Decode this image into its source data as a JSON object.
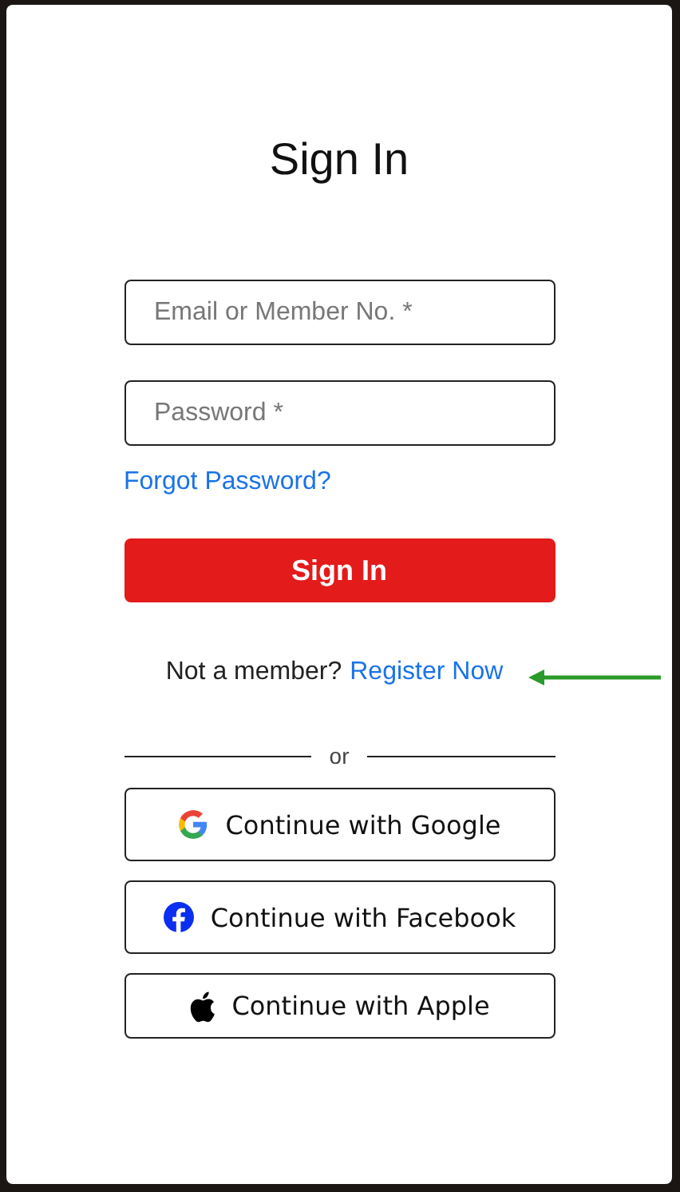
{
  "title": "Sign In",
  "fields": [
    {
      "placeholder": "Email or Member No. *"
    },
    {
      "placeholder": "Password *"
    }
  ],
  "forgot_link": "Forgot Password?",
  "submit": "Sign In",
  "register": {
    "prompt": "Not a member?",
    "link": "Register Now"
  },
  "divider_text": "or",
  "social_buttons": [
    {
      "kind": "google",
      "label": "Continue with Google"
    },
    {
      "kind": "facebook",
      "label": "Continue with Facebook"
    },
    {
      "kind": "apple",
      "label": "Continue with Apple"
    }
  ]
}
